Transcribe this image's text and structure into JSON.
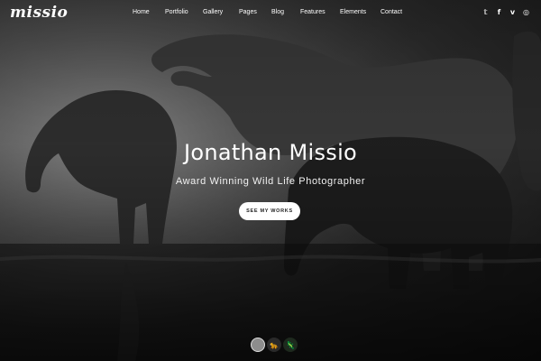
{
  "brand": {
    "logo": "missio"
  },
  "nav": {
    "items": [
      "Home",
      "Portfolio",
      "Gallery",
      "Pages",
      "Blog",
      "Features",
      "Elements",
      "Contact"
    ]
  },
  "social": {
    "icons": [
      {
        "name": "twitter-icon",
        "glyph": "𝕥"
      },
      {
        "name": "facebook-icon",
        "glyph": "f"
      },
      {
        "name": "vimeo-icon",
        "glyph": "v"
      },
      {
        "name": "instagram-icon",
        "glyph": "◎"
      }
    ]
  },
  "hero": {
    "title": "Jonathan Missio",
    "subtitle": "Award Winning Wild Life Photographer",
    "cta_label": "SEE MY WORKS"
  },
  "slider": {
    "thumbs": [
      {
        "name": "slide-thumb-1",
        "glyph": ""
      },
      {
        "name": "slide-thumb-2",
        "glyph": "🐆"
      },
      {
        "name": "slide-thumb-3",
        "glyph": "🦎"
      }
    ]
  }
}
